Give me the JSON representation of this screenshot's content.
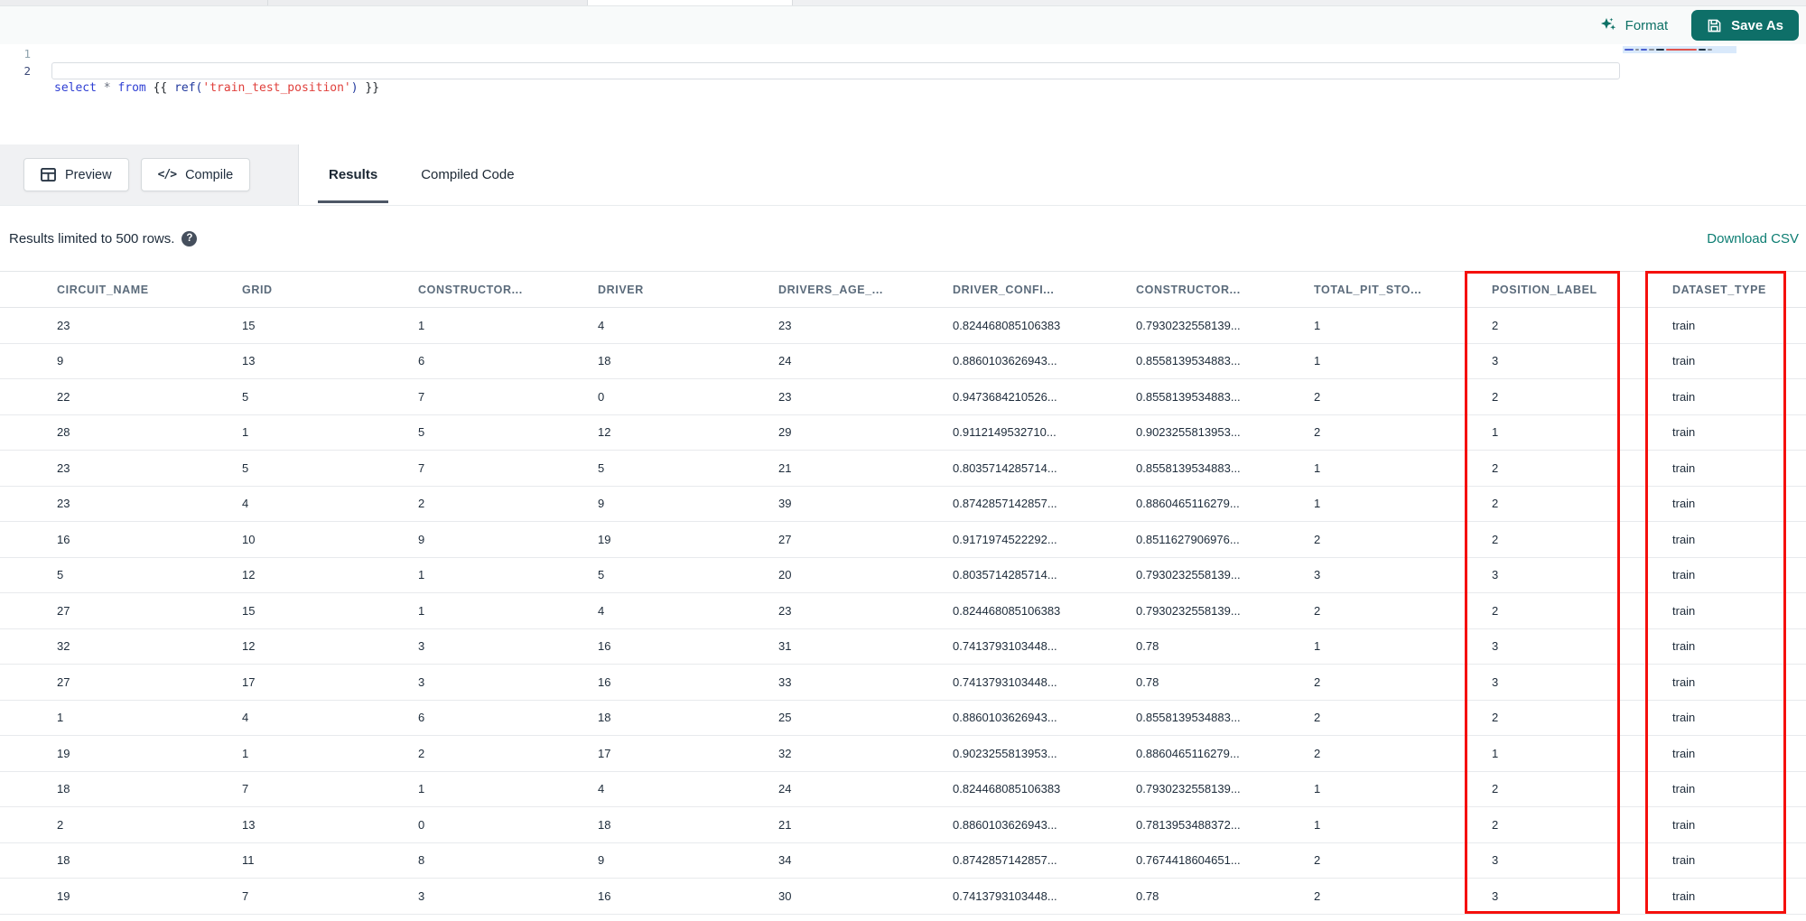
{
  "toolbar": {
    "format_label": "Format",
    "save_as_label": "Save As"
  },
  "editor": {
    "line_numbers": [
      "1",
      "2"
    ],
    "code_tokens": [
      {
        "text": "select",
        "type": "keyword"
      },
      {
        "text": " ",
        "type": "plain"
      },
      {
        "text": "*",
        "type": "operator"
      },
      {
        "text": " ",
        "type": "plain"
      },
      {
        "text": "from",
        "type": "keyword"
      },
      {
        "text": " ",
        "type": "plain"
      },
      {
        "text": "{{ ",
        "type": "brace"
      },
      {
        "text": "ref(",
        "type": "function"
      },
      {
        "text": "'train_test_position'",
        "type": "string"
      },
      {
        "text": ")",
        "type": "function"
      },
      {
        "text": " }}",
        "type": "brace"
      }
    ]
  },
  "action_bar": {
    "preview_label": "Preview",
    "compile_label": "Compile",
    "compile_glyph": "</>",
    "tabs": [
      {
        "label": "Results",
        "active": true
      },
      {
        "label": "Compiled Code",
        "active": false
      }
    ]
  },
  "results_bar": {
    "limit_text": "Results limited to 500 rows.",
    "help_glyph": "?",
    "download_csv_label": "Download CSV"
  },
  "table": {
    "columns": [
      "CIRCUIT_NAME",
      "GRID",
      "CONSTRUCTOR...",
      "DRIVER",
      "DRIVERS_AGE_...",
      "DRIVER_CONFI...",
      "CONSTRUCTOR...",
      "TOTAL_PIT_STO...",
      "POSITION_LABEL",
      "DATASET_TYPE"
    ],
    "rows": [
      [
        "23",
        "15",
        "1",
        "4",
        "23",
        "0.824468085106383",
        "0.7930232558139...",
        "1",
        "2",
        "train"
      ],
      [
        "9",
        "13",
        "6",
        "18",
        "24",
        "0.8860103626943...",
        "0.8558139534883...",
        "1",
        "3",
        "train"
      ],
      [
        "22",
        "5",
        "7",
        "0",
        "23",
        "0.9473684210526...",
        "0.8558139534883...",
        "2",
        "2",
        "train"
      ],
      [
        "28",
        "1",
        "5",
        "12",
        "29",
        "0.9112149532710...",
        "0.9023255813953...",
        "2",
        "1",
        "train"
      ],
      [
        "23",
        "5",
        "7",
        "5",
        "21",
        "0.8035714285714...",
        "0.8558139534883...",
        "1",
        "2",
        "train"
      ],
      [
        "23",
        "4",
        "2",
        "9",
        "39",
        "0.8742857142857...",
        "0.8860465116279...",
        "1",
        "2",
        "train"
      ],
      [
        "16",
        "10",
        "9",
        "19",
        "27",
        "0.9171974522292...",
        "0.8511627906976...",
        "2",
        "2",
        "train"
      ],
      [
        "5",
        "12",
        "1",
        "5",
        "20",
        "0.8035714285714...",
        "0.7930232558139...",
        "3",
        "3",
        "train"
      ],
      [
        "27",
        "15",
        "1",
        "4",
        "23",
        "0.824468085106383",
        "0.7930232558139...",
        "2",
        "2",
        "train"
      ],
      [
        "32",
        "12",
        "3",
        "16",
        "31",
        "0.7413793103448...",
        "0.78",
        "1",
        "3",
        "train"
      ],
      [
        "27",
        "17",
        "3",
        "16",
        "33",
        "0.7413793103448...",
        "0.78",
        "2",
        "3",
        "train"
      ],
      [
        "1",
        "4",
        "6",
        "18",
        "25",
        "0.8860103626943...",
        "0.8558139534883...",
        "2",
        "2",
        "train"
      ],
      [
        "19",
        "1",
        "2",
        "17",
        "32",
        "0.9023255813953...",
        "0.8860465116279...",
        "2",
        "1",
        "train"
      ],
      [
        "18",
        "7",
        "1",
        "4",
        "24",
        "0.824468085106383",
        "0.7930232558139...",
        "1",
        "2",
        "train"
      ],
      [
        "2",
        "13",
        "0",
        "18",
        "21",
        "0.8860103626943...",
        "0.7813953488372...",
        "1",
        "2",
        "train"
      ],
      [
        "18",
        "11",
        "8",
        "9",
        "34",
        "0.8742857142857...",
        "0.7674418604651...",
        "2",
        "3",
        "train"
      ],
      [
        "19",
        "7",
        "3",
        "16",
        "30",
        "0.7413793103448...",
        "0.78",
        "2",
        "3",
        "train"
      ]
    ]
  },
  "annotations": {
    "highlight_color": "#f5100d",
    "highlighted_columns": [
      "POSITION_LABEL",
      "DATASET_TYPE"
    ]
  },
  "colors": {
    "accent_teal": "#0d7166",
    "save_button_bg": "#0e6f68",
    "link_teal": "#0c7d72",
    "tab_underline": "#4d5766",
    "keyword_blue": "#2f3fd3",
    "string_red": "#e0403c"
  }
}
